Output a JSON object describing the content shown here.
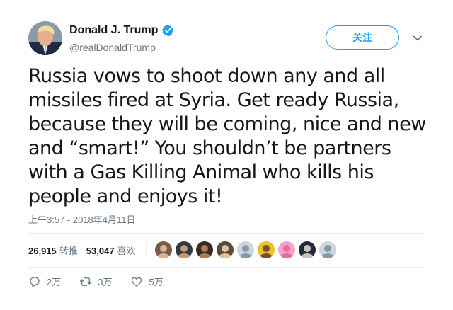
{
  "user": {
    "name": "Donald J. Trump",
    "handle": "@realDonaldTrump"
  },
  "follow_button": {
    "label": "关注"
  },
  "tweet": {
    "text": "Russia vows to shoot down any and all missiles fired at Syria. Get ready Russia, because they will be coming, nice and new and “smart!” You shouldn’t be partners with a Gas Killing Animal who kills his people and enjoys it!",
    "timestamp": "上午3:57 - 2018年4月11日"
  },
  "stats": {
    "retweets_count": "26,915",
    "retweets_label": "转推",
    "likes_count": "53,047",
    "likes_label": "喜欢"
  },
  "liker_avatars": [
    {
      "bg": "#7a5a48",
      "fg": "#d8b394"
    },
    {
      "bg": "#2b3a44",
      "fg": "#c79a6c"
    },
    {
      "bg": "#3b2a22",
      "fg": "#a97b5b"
    },
    {
      "bg": "#5a4a3c",
      "fg": "#e0c2a0"
    },
    {
      "bg": "#ccd6dd",
      "fg": "#8899a6"
    },
    {
      "bg": "#e8c12c",
      "fg": "#7a4f2a"
    },
    {
      "bg": "#f3a5c8",
      "fg": "#e86aa0"
    },
    {
      "bg": "#1f2a3a",
      "fg": "#d0c0b0"
    },
    {
      "bg": "#ccd6dd",
      "fg": "#8899a6"
    }
  ],
  "actions": {
    "replies": "2万",
    "retweets": "3万",
    "likes": "5万"
  },
  "colors": {
    "accent": "#1da1f2",
    "text": "#14171a",
    "secondary": "#657786",
    "divider": "#e6ecf0"
  }
}
